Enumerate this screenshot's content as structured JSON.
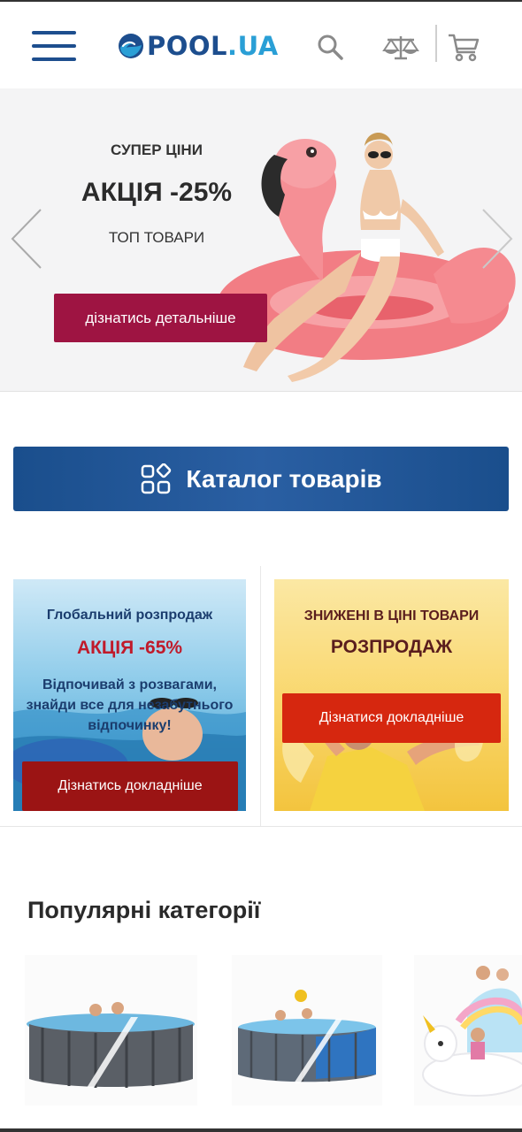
{
  "header": {
    "logo_text_main": "POOL",
    "logo_text_dot": ".",
    "logo_text_tld": "UA",
    "icons": [
      "menu-icon",
      "search-icon",
      "compare-scales-icon",
      "cart-icon"
    ]
  },
  "hero": {
    "line1": "СУПЕР ЦІНИ",
    "line2": "АКЦІЯ -25%",
    "line3": "ТОП ТОВАРИ",
    "button": "дізнатись детальніше"
  },
  "catalog": {
    "label": "Каталог товарів"
  },
  "promo_left": {
    "title": "Глобальний розпродаж",
    "discount": "АКЦІЯ -65%",
    "text": "Відпочивай з розвагами, знайди все для незабутнього відпочинку!",
    "button": "Дізнатись докладніше"
  },
  "promo_right": {
    "title": "ЗНИЖЕНІ В ЦІНІ ТОВАРИ",
    "subtitle": "РОЗПРОДАЖ",
    "button": "Дізнатися докладніше"
  },
  "popular": {
    "title": "Популярні категорії"
  },
  "colors": {
    "brand_blue": "#1d4e8e",
    "hero_button": "#9e1442",
    "promo_left_button": "#9b1414",
    "promo_right_button": "#d6270f"
  }
}
